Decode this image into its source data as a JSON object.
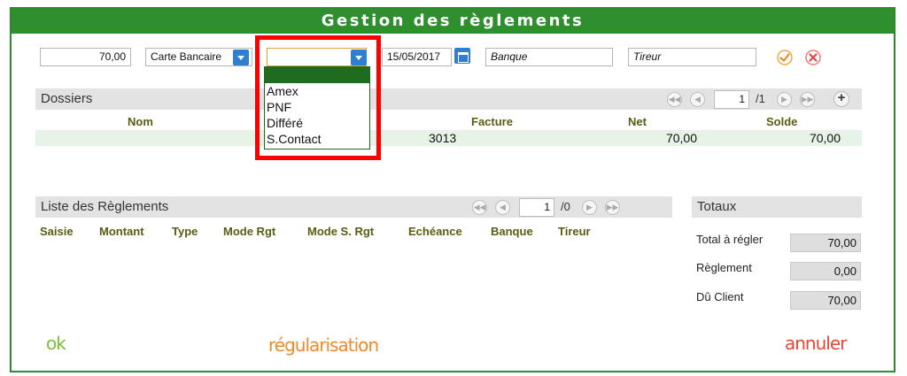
{
  "window": {
    "title": "Gestion des règlements"
  },
  "form": {
    "amount": "70,00",
    "payment_mode": "Carte Bancaire",
    "sub_mode": "",
    "date": "15/05/2017",
    "bank_placeholder": "Banque",
    "drawer_placeholder": "Tireur"
  },
  "sub_mode_dropdown": {
    "options": [
      "Amex",
      "PNF",
      "Différé",
      "S.Contact"
    ]
  },
  "dossiers": {
    "title": "Dossiers",
    "page": "1",
    "page_total": "/1",
    "columns": [
      "Nom",
      "Facture",
      "Net",
      "Solde"
    ],
    "rows": [
      {
        "nom": "",
        "facture": "3013",
        "net": "70,00",
        "solde": "70,00"
      }
    ]
  },
  "reglements": {
    "title": "Liste des Règlements",
    "page": "1",
    "page_total": "/0",
    "columns": [
      "Saisie",
      "Montant",
      "Type",
      "Mode Rgt",
      "Mode S. Rgt",
      "Echéance",
      "Banque",
      "Tireur"
    ]
  },
  "totaux": {
    "title": "Totaux",
    "items": [
      {
        "label": "Total à régler",
        "value": "70,00"
      },
      {
        "label": "Règlement",
        "value": "0,00"
      },
      {
        "label": "Dû Client",
        "value": "70,00"
      }
    ]
  },
  "actions": {
    "ok": "ok",
    "regularisation": "régularisation",
    "annuler": "annuler"
  },
  "colors": {
    "title_bar": "#2f8f2f",
    "highlight": "#ff0000",
    "ok": "#7cbf3a",
    "regularisation": "#f08a2a",
    "annuler": "#e34a35"
  }
}
